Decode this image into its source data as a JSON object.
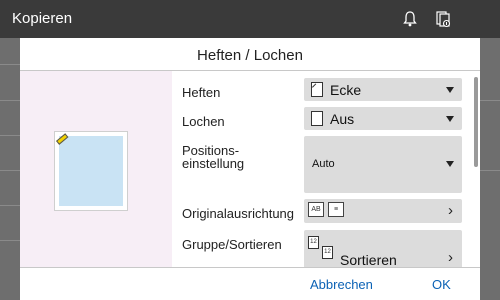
{
  "app": {
    "title": "Kopieren"
  },
  "topbar": {
    "bell_icon": "bell-icon",
    "jobs_icon": "job-list-icon"
  },
  "dialog": {
    "title": "Heften / Lochen",
    "rows": {
      "heften": {
        "label": "Heften",
        "value": "Ecke"
      },
      "lochen": {
        "label": "Lochen",
        "value": "Aus"
      },
      "position": {
        "label_line1": "Positions-",
        "label_line2": "einstellung",
        "value": "Auto"
      },
      "original": {
        "label": "Originalausrichtung"
      },
      "gruppe": {
        "label": "Gruppe/Sortieren",
        "value": "Sortieren"
      }
    },
    "footer": {
      "cancel": "Abbrechen",
      "ok": "OK"
    }
  },
  "colors": {
    "accent": "#0b62b5",
    "staple": "#f2d100",
    "preview_bg": "#f7eef6",
    "paper_fill": "#c9e3f4"
  }
}
